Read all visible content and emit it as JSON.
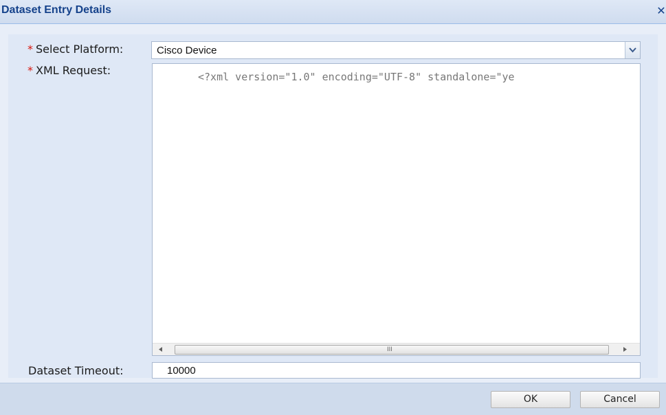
{
  "dialog": {
    "title": "Dataset Entry Details",
    "close_icon": "close-icon"
  },
  "form": {
    "required_marker": "*",
    "platform": {
      "label": "Select Platform:",
      "value": "Cisco Device",
      "trigger_icon": "chevron-down-icon"
    },
    "xml_request": {
      "label": "XML Request:",
      "value": "<?xml version=\"1.0\" encoding=\"UTF-8\" standalone=\"ye",
      "scrollbar": {
        "left_icon": "arrow-left-icon",
        "right_icon": "arrow-right-icon",
        "grip": "III"
      }
    },
    "timeout": {
      "label": "Dataset Timeout:",
      "value": "10000"
    }
  },
  "buttons": {
    "ok": "OK",
    "cancel": "Cancel"
  },
  "colors": {
    "title_text": "#15428b",
    "required": "#d9180f",
    "panel_bg": "#dfe8f6"
  }
}
